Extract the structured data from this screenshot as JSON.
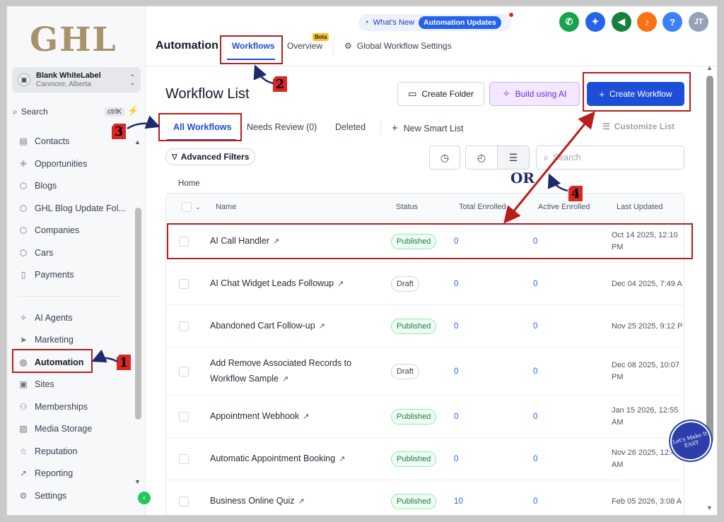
{
  "logo": "GHL",
  "account": {
    "name": "Blank WhiteLabel",
    "location": "Canmore, Alberta",
    "avatar_icon": "building-icon"
  },
  "search": {
    "label": "Search",
    "shortcut": "ctrlK"
  },
  "nav_items": [
    {
      "label": "Contacts",
      "icon": "contacts-icon"
    },
    {
      "label": "Opportunities",
      "icon": "opportunities-icon"
    },
    {
      "label": "Blogs",
      "icon": "cube-icon"
    },
    {
      "label": "GHL Blog Update Fol...",
      "icon": "cube-icon"
    },
    {
      "label": "Companies",
      "icon": "cube-icon"
    },
    {
      "label": "Cars",
      "icon": "cube-icon"
    },
    {
      "label": "Payments",
      "icon": "payments-icon"
    },
    {
      "label": "AI Agents",
      "icon": "sparkle-icon"
    },
    {
      "label": "Marketing",
      "icon": "send-icon"
    },
    {
      "label": "Automation",
      "icon": "automation-icon"
    },
    {
      "label": "Sites",
      "icon": "sites-icon"
    },
    {
      "label": "Memberships",
      "icon": "memberships-icon"
    },
    {
      "label": "Media Storage",
      "icon": "image-icon"
    },
    {
      "label": "Reputation",
      "icon": "star-icon"
    },
    {
      "label": "Reporting",
      "icon": "trend-icon"
    },
    {
      "label": "Settings",
      "icon": "gear-icon"
    }
  ],
  "topbar": {
    "whats_new": "What's New",
    "updates_pill": "Automation Updates",
    "avatar_initials": "JT"
  },
  "header": {
    "title": "Automation",
    "tabs": [
      "Workflows",
      "Overview",
      "Global Workflow Settings"
    ],
    "beta": "Beta"
  },
  "main": {
    "title": "Workflow List",
    "create_folder": "Create Folder",
    "build_ai": "Build using AI",
    "create_workflow": "Create Workflow",
    "filter_tabs": [
      "All Workflows",
      "Needs Review (0)",
      "Deleted"
    ],
    "new_smart_list": "New Smart List",
    "customize_list": "Customize List",
    "advanced_filters": "Advanced Filters",
    "search_placeholder": "Search",
    "breadcrumb": "Home"
  },
  "table": {
    "columns": [
      "Name",
      "Status",
      "Total Enrolled",
      "Active Enrolled",
      "Last Updated"
    ],
    "rows": [
      {
        "name": "AI Call Handler",
        "status": "Published",
        "total": "0",
        "active": "0",
        "updated": "Oct 14 2025, 12:10 PM"
      },
      {
        "name": "AI Chat Widget Leads Followup",
        "status": "Draft",
        "total": "0",
        "active": "0",
        "updated": "Dec 04 2025, 7:49 A"
      },
      {
        "name": "Abandoned Cart Follow-up",
        "status": "Published",
        "total": "0",
        "active": "0",
        "updated": "Nov 25 2025, 9:12 P"
      },
      {
        "name": "Add Remove Associated Records to Workflow Sample",
        "status": "Draft",
        "total": "0",
        "active": "0",
        "updated": "Dec 08 2025, 10:07 PM"
      },
      {
        "name": "Appointment Webhook",
        "status": "Published",
        "total": "0",
        "active": "0",
        "updated": "Jan 15 2026, 12:55 AM"
      },
      {
        "name": "Automatic Appointment Booking",
        "status": "Published",
        "total": "0",
        "active": "0",
        "updated": "Nov 26 2025, 12:4 AM"
      },
      {
        "name": "Business Online Quiz",
        "status": "Published",
        "total": "10",
        "active": "0",
        "updated": "Feb 05 2026, 3:08 A"
      }
    ]
  },
  "annotations": {
    "n1": "1",
    "n2": "2",
    "n3": "3",
    "n4": "4",
    "or": "OR"
  },
  "watermark": "Let's Make It EASY",
  "colors": {
    "accent": "#1d4ed8",
    "annotation": "#b91c1c",
    "published": "#15803d"
  }
}
